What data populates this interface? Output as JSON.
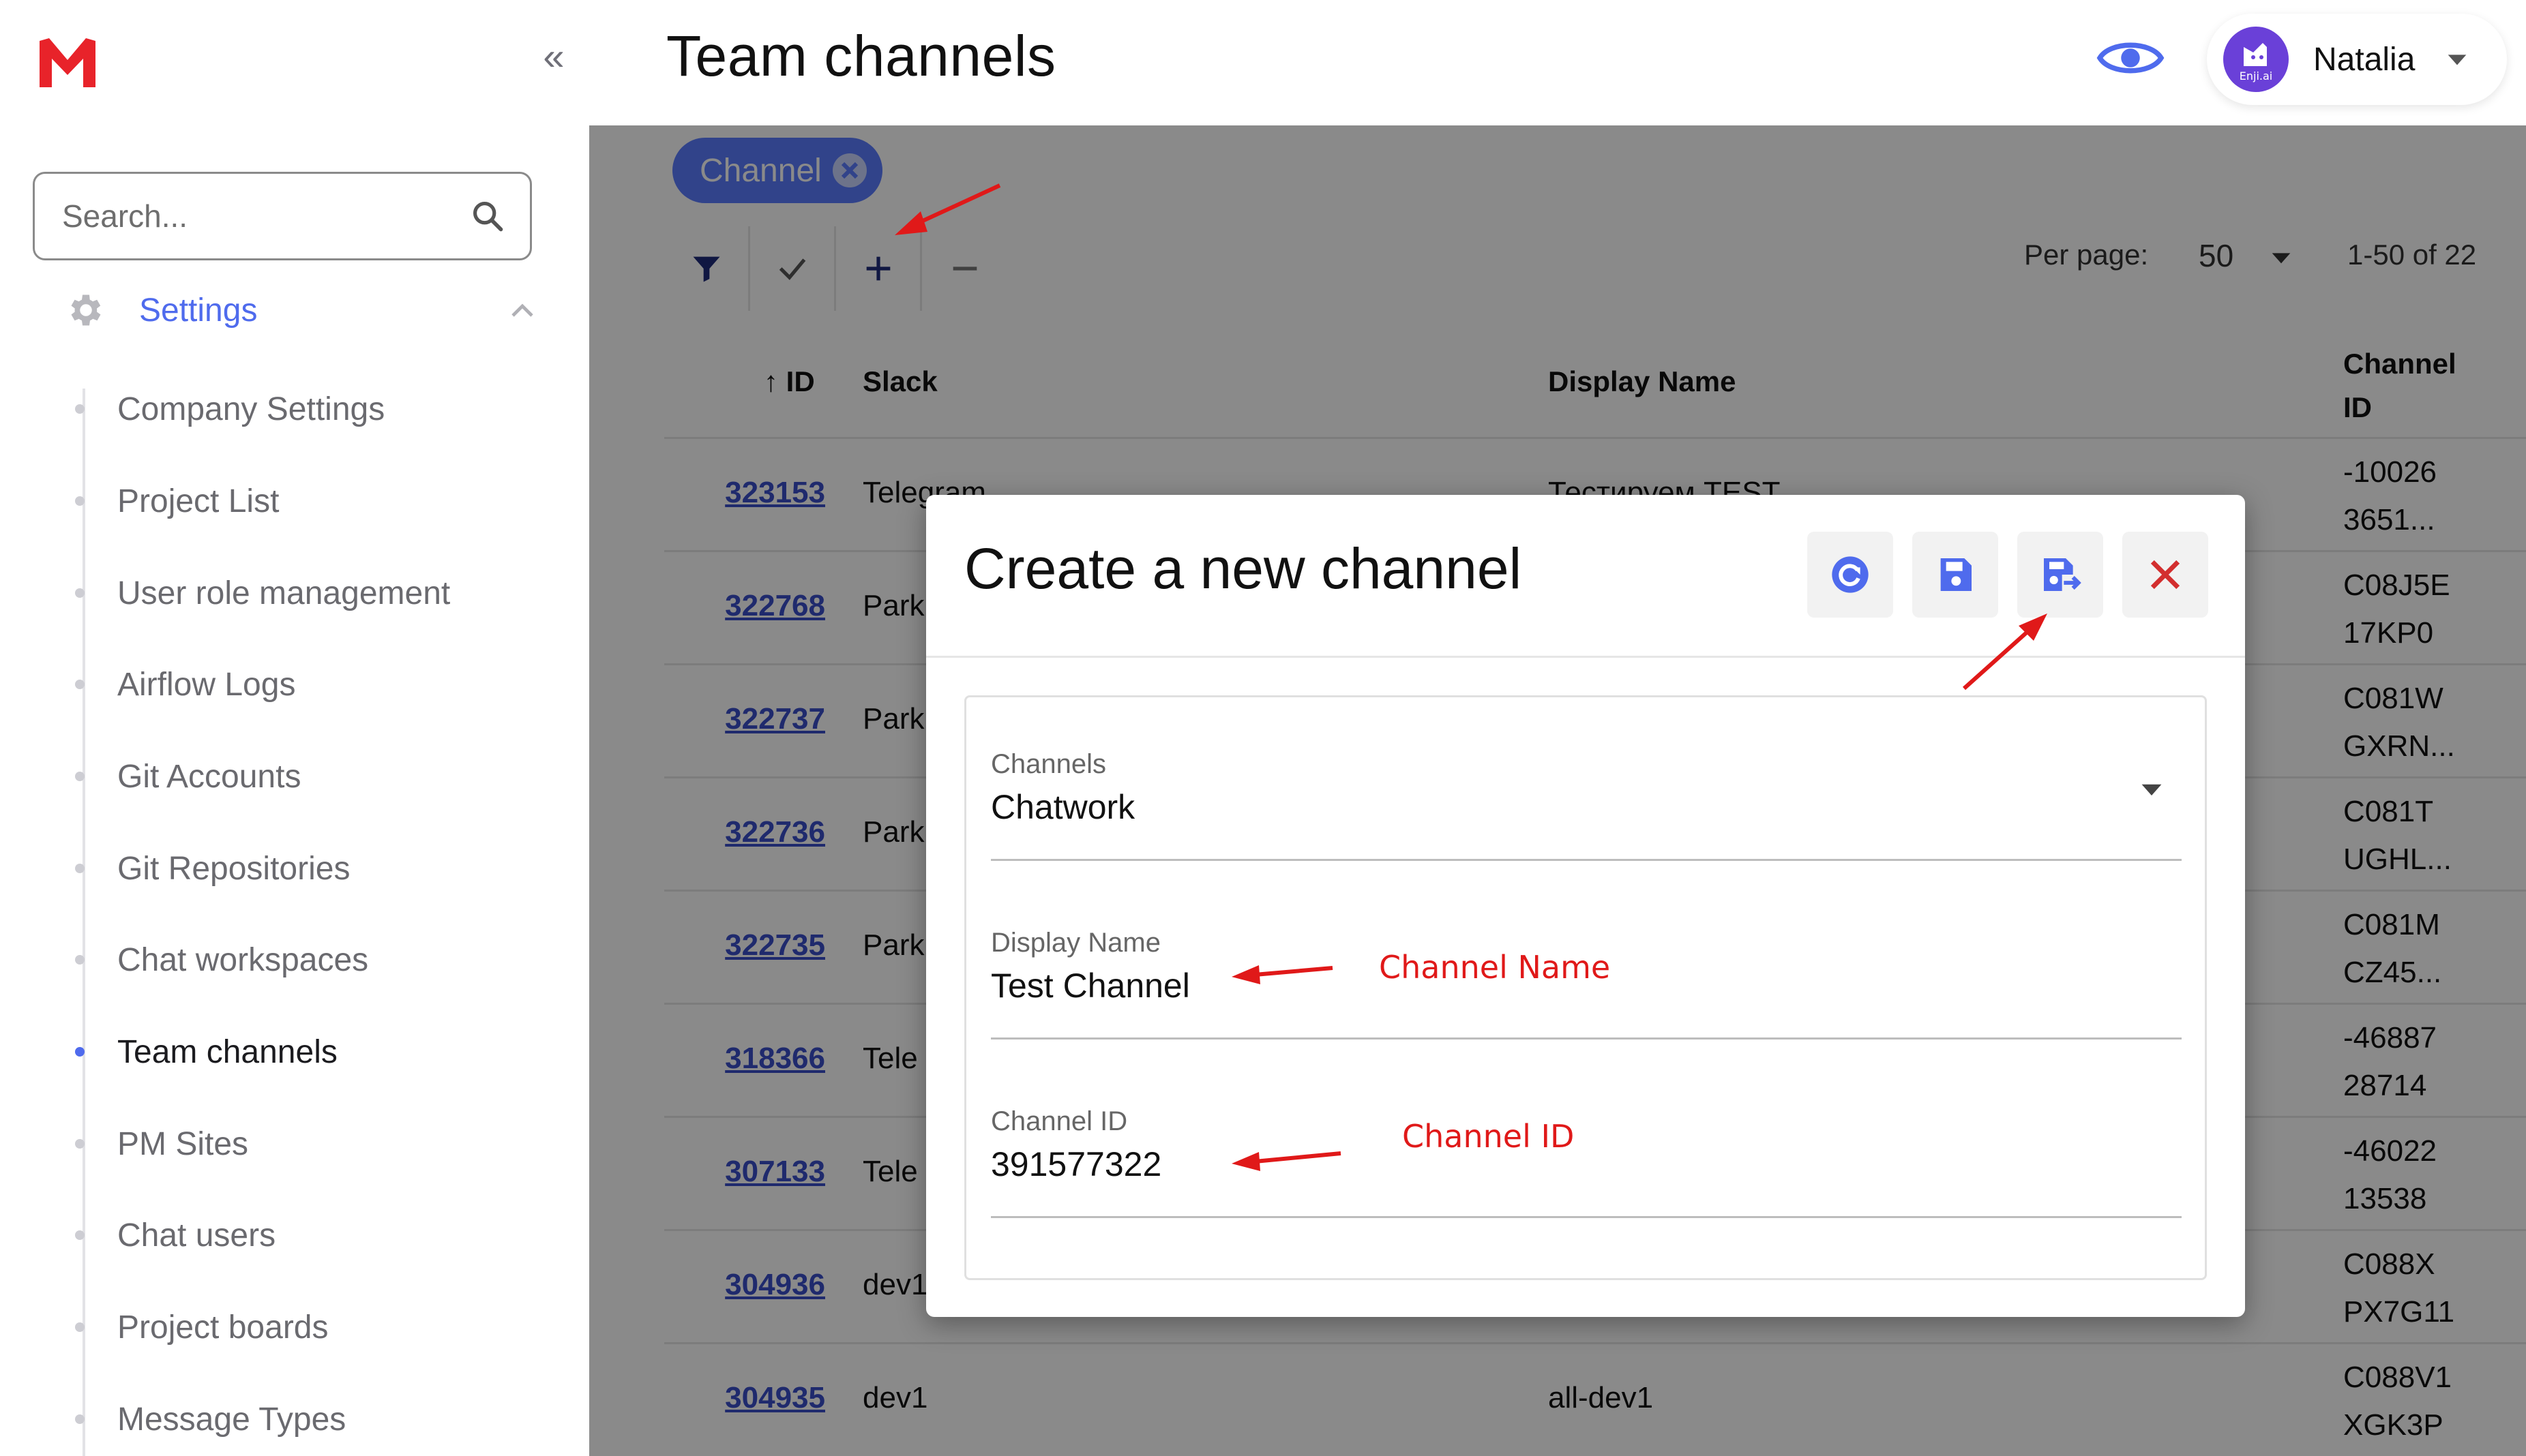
{
  "sidebar": {
    "collapse_glyph": "«",
    "search_placeholder": "Search...",
    "settings_label": "Settings",
    "items": [
      {
        "label": "Company Settings"
      },
      {
        "label": "Project List"
      },
      {
        "label": "User role management"
      },
      {
        "label": "Airflow Logs"
      },
      {
        "label": "Git Accounts"
      },
      {
        "label": "Git Repositories"
      },
      {
        "label": "Chat workspaces"
      },
      {
        "label": "Team channels",
        "active": true
      },
      {
        "label": "PM Sites"
      },
      {
        "label": "Chat users"
      },
      {
        "label": "Project boards"
      },
      {
        "label": "Message Types"
      }
    ]
  },
  "header": {
    "title": "Team channels",
    "user_name": "Natalia",
    "avatar_text": "Enji.ai"
  },
  "filter_chip": {
    "label": "Channel"
  },
  "pagination": {
    "per_page_label": "Per page:",
    "per_page_value": "50",
    "range": "1-50 of 22"
  },
  "table": {
    "headers": {
      "id": "↑ ID",
      "slack": "Slack",
      "display_name": "Display Name",
      "channel_id_line1": "Channel",
      "channel_id_line2": "ID"
    },
    "rows": [
      {
        "id": "323153",
        "slack": "Telegram",
        "display_name": "Тестируем TEST",
        "channel_id_1": "-10026",
        "channel_id_2": "3651..."
      },
      {
        "id": "322768",
        "slack": "Park",
        "display_name": "",
        "channel_id_1": "C08J5E",
        "channel_id_2": "17KP0"
      },
      {
        "id": "322737",
        "slack": "Park",
        "display_name": "",
        "channel_id_1": "C081W",
        "channel_id_2": "GXRN..."
      },
      {
        "id": "322736",
        "slack": "Park",
        "display_name": "",
        "channel_id_1": "C081T",
        "channel_id_2": "UGHL..."
      },
      {
        "id": "322735",
        "slack": "Park",
        "display_name": "",
        "channel_id_1": "C081M",
        "channel_id_2": "CZ45..."
      },
      {
        "id": "318366",
        "slack": "Tele",
        "display_name": "",
        "channel_id_1": "-46887",
        "channel_id_2": "28714"
      },
      {
        "id": "307133",
        "slack": "Tele",
        "display_name": "",
        "channel_id_1": "-46022",
        "channel_id_2": "13538"
      },
      {
        "id": "304936",
        "slack": "dev1",
        "display_name": "",
        "channel_id_1": "C088X",
        "channel_id_2": "PX7G11"
      },
      {
        "id": "304935",
        "slack": "dev1",
        "display_name": "all-dev1",
        "channel_id_1": "C088V1",
        "channel_id_2": "XGK3P"
      }
    ]
  },
  "modal": {
    "title": "Create a new channel",
    "fields": {
      "channels": {
        "label": "Channels",
        "value": "Chatwork"
      },
      "display_name": {
        "label": "Display Name",
        "value": "Test Channel"
      },
      "channel_id": {
        "label": "Channel ID",
        "value": "391577322"
      }
    }
  },
  "annotations": {
    "channel_name": "Channel Name",
    "channel_id": "Channel ID"
  },
  "colors": {
    "accent": "#4f6bed",
    "chip": "#5b7cff",
    "annotation": "#e01919",
    "logo": "#e8232a",
    "avatar": "#6a40d8"
  }
}
